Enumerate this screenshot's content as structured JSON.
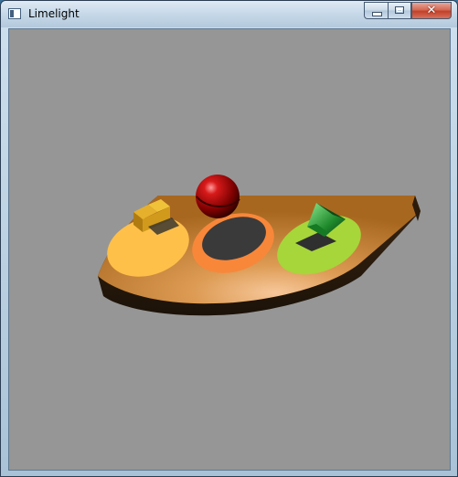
{
  "window": {
    "title": "Limelight",
    "icon": "app-window-icon",
    "buttons": {
      "minimize": "minimize-icon",
      "maximize": "maximize-icon",
      "close_glyph": "✕"
    }
  },
  "viewport": {
    "background": "#969696",
    "scene": {
      "platform_color": "#c47f2e",
      "spots": [
        "#ffc04a",
        "#f8873a",
        "#a6d63a"
      ],
      "objects": [
        "cube",
        "sphere",
        "pyramid"
      ]
    }
  }
}
